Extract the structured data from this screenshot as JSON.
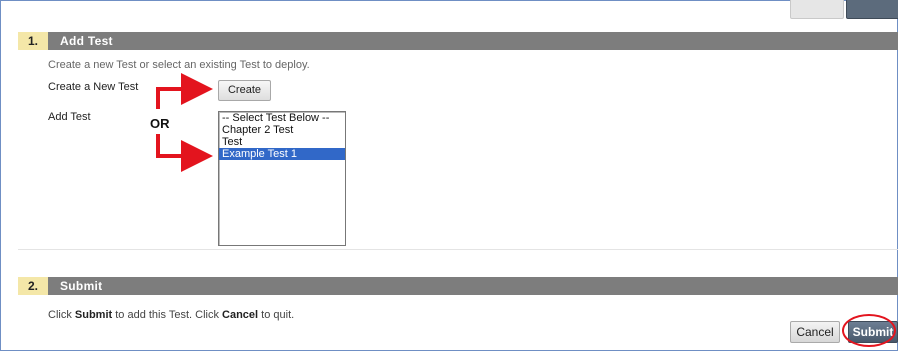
{
  "section_add_test": {
    "number": "1.",
    "title": "Add Test",
    "instructions": "Create a new Test or select an existing Test to deploy.",
    "create_label": "Create a New Test",
    "create_button": "Create",
    "add_label": "Add Test",
    "or_label": "OR",
    "test_list": {
      "options": [
        "-- Select Test Below --",
        "Chapter 2 Test",
        "Test",
        "Example Test 1"
      ],
      "selected": "Example Test 1"
    }
  },
  "section_submit": {
    "number": "2.",
    "title": "Submit",
    "note_prefix": "Click ",
    "note_submit": "Submit",
    "note_middle": " to add this Test. Click ",
    "note_cancel": "Cancel",
    "note_suffix": " to quit.",
    "cancel_button": "Cancel",
    "submit_button": "Submit"
  },
  "colors": {
    "header_bar": "#7d7d7d",
    "step_badge": "#f4e7a8",
    "selection": "#3168c8",
    "annotation": "#e3141e"
  }
}
